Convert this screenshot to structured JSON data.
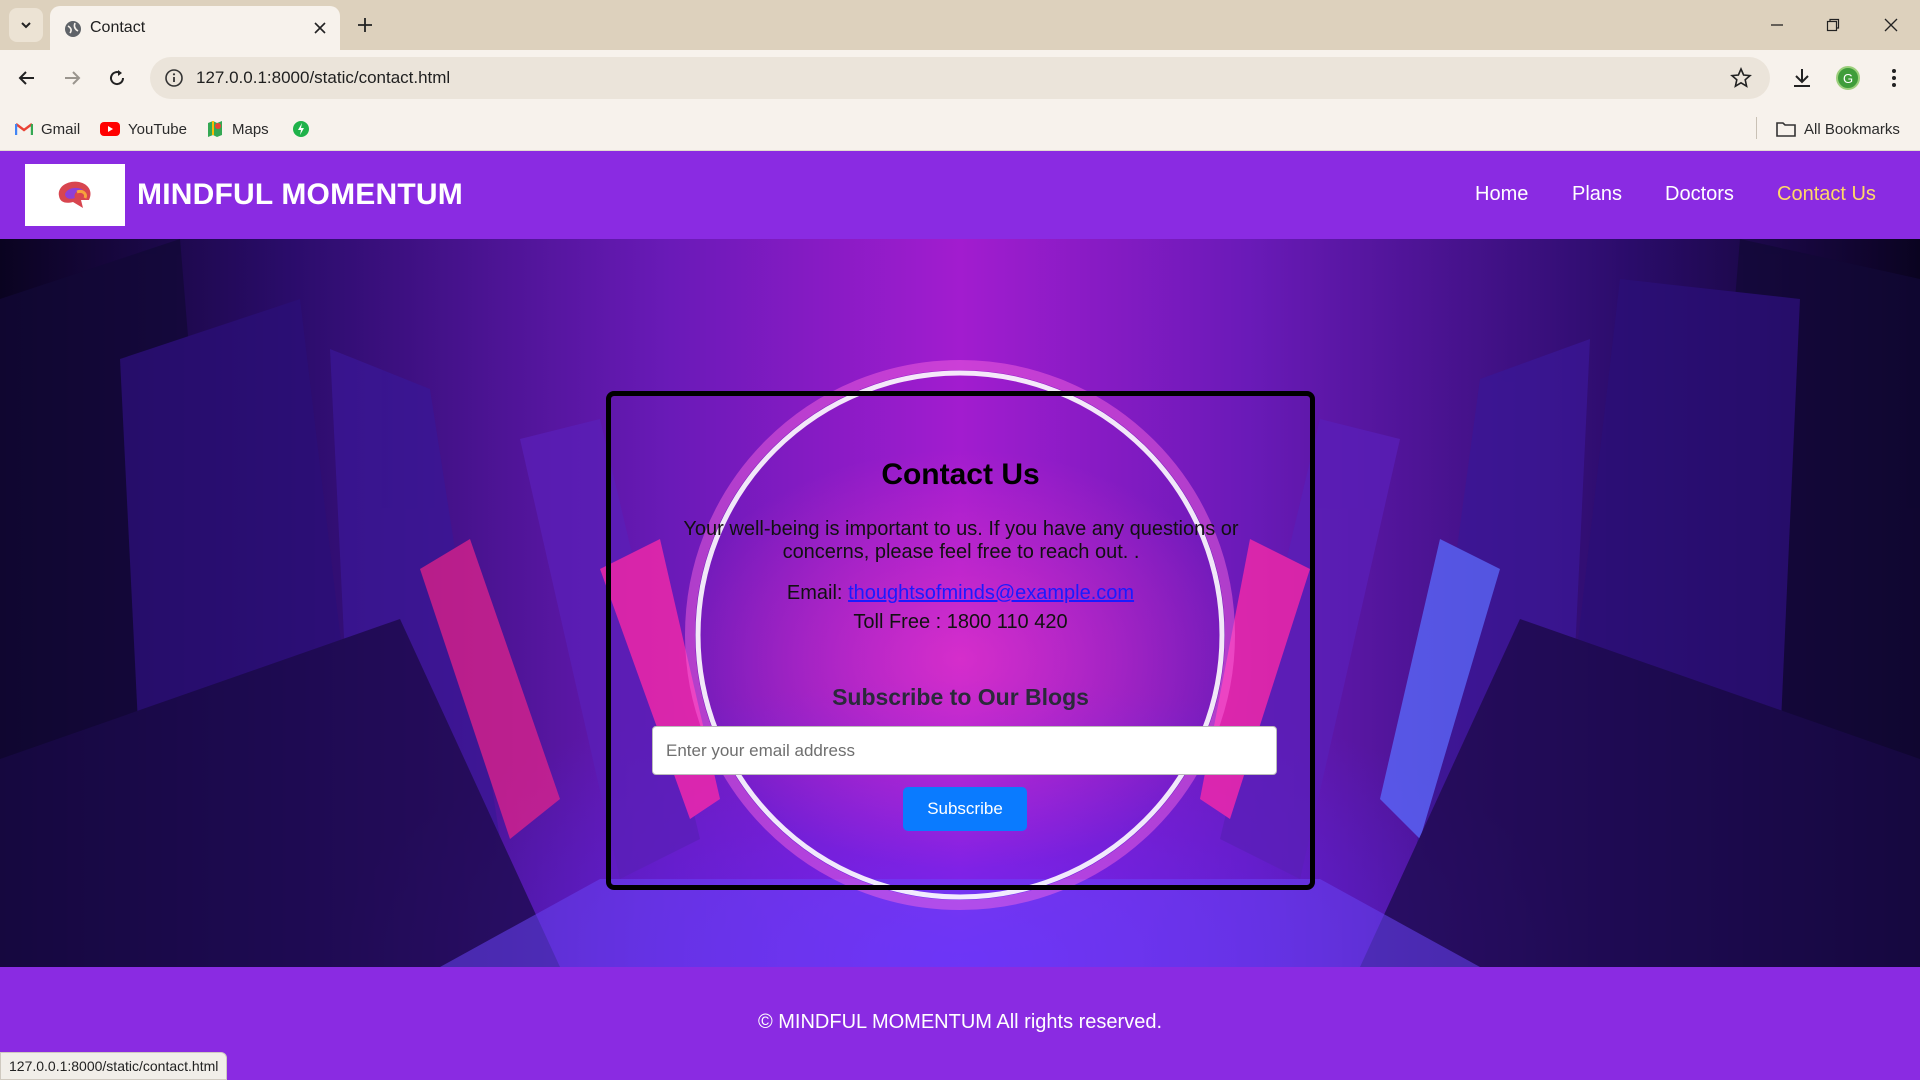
{
  "browser": {
    "tab": {
      "title": "Contact"
    },
    "address": {
      "url": "127.0.0.1:8000/static/contact.html"
    },
    "profile_initial": "G",
    "bookmarks": [
      {
        "label": "Gmail",
        "icon": "gmail-icon"
      },
      {
        "label": "YouTube",
        "icon": "youtube-icon"
      },
      {
        "label": "Maps",
        "icon": "maps-icon"
      },
      {
        "label": "",
        "icon": "green-extension-icon"
      }
    ],
    "all_bookmarks_label": "All Bookmarks",
    "status_url": "127.0.0.1:8000/static/contact.html"
  },
  "site": {
    "brand": "MINDFUL MOMENTUM",
    "nav": [
      {
        "label": "Home",
        "active": false
      },
      {
        "label": "Plans",
        "active": false
      },
      {
        "label": "Doctors",
        "active": false
      },
      {
        "label": "Contact Us",
        "active": true
      }
    ],
    "contact": {
      "title": "Contact Us",
      "text": "Your well-being is important to us. If you have any questions or concerns, please feel free to reach out. .",
      "email_label": "Email:",
      "email": "thoughtsofminds@example.com",
      "toll_free": "Toll Free : 1800 110 420"
    },
    "subscribe": {
      "title": "Subscribe to Our Blogs",
      "placeholder": "Enter your email address",
      "button": "Subscribe"
    },
    "footer": "© MINDFUL MOMENTUM All rights reserved."
  },
  "colors": {
    "header_bg": "#8a2be2",
    "nav_active": "#ffd966",
    "button_bg": "#0a7bff"
  }
}
